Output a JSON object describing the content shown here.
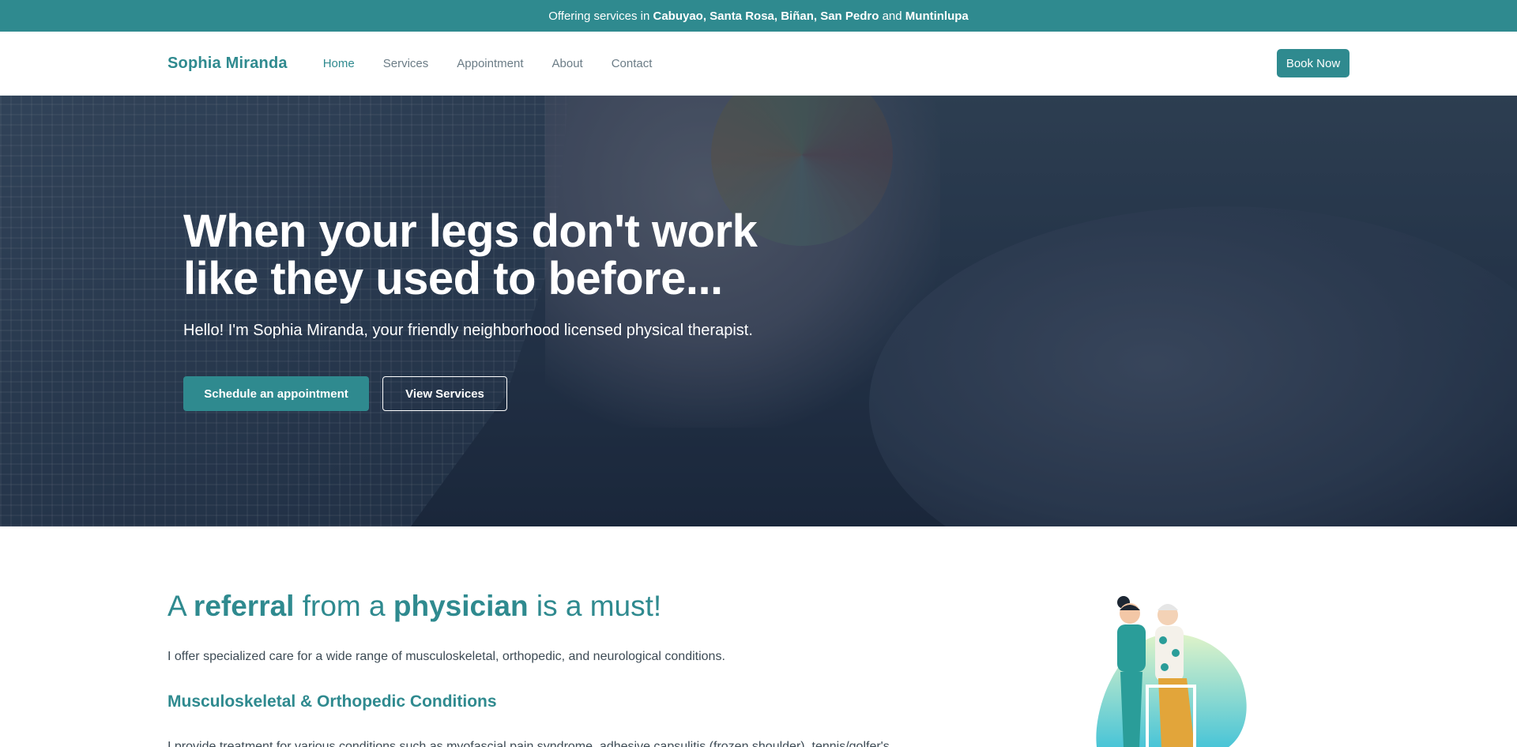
{
  "topbar": {
    "prefix": "Offering services in ",
    "cities": "Cabuyao, Santa Rosa, Biñan, San Pedro",
    "conj": " and ",
    "last_city": "Muntinlupa"
  },
  "nav": {
    "brand": "Sophia Miranda",
    "items": [
      {
        "label": "Home",
        "active": true
      },
      {
        "label": "Services"
      },
      {
        "label": "Appointment"
      },
      {
        "label": "About"
      },
      {
        "label": "Contact"
      }
    ],
    "book_label": "Book Now"
  },
  "hero": {
    "title_line1": "When your legs don't work",
    "title_line2": "like they used to before...",
    "subtitle": "Hello! I'm Sophia Miranda, your friendly neighborhood licensed physical therapist.",
    "primary_button": "Schedule an appointment",
    "secondary_button": "View Services"
  },
  "section": {
    "heading_a": "A ",
    "heading_b": "referral",
    "heading_c": " from a ",
    "heading_d": "physician",
    "heading_e": " is a must!",
    "intro": "I offer specialized care for a wide range of musculoskeletal, orthopedic, and neurological conditions.",
    "subheading": "Musculoskeletal & Orthopedic Conditions",
    "detail": "I provide treatment for various conditions such as myofascial pain syndrome, adhesive capsulitis (frozen shoulder), tennis/golfer's"
  },
  "colors": {
    "brand": "#2f8a8f",
    "hero_overlay": "#1e2b40"
  }
}
